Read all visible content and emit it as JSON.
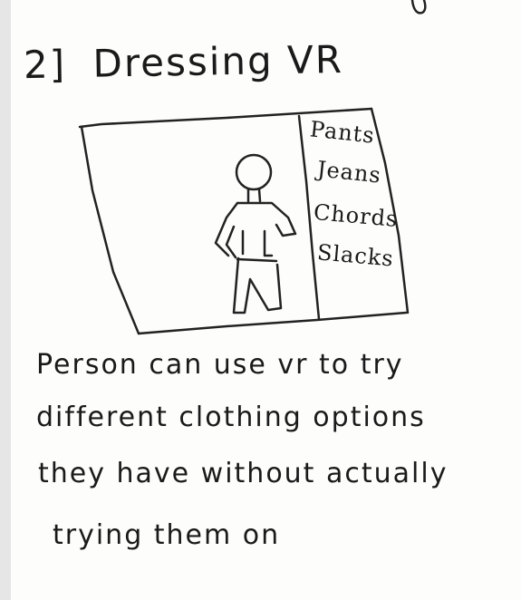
{
  "heading": {
    "number": "2]",
    "title": "Dressing VR"
  },
  "menu": {
    "items": [
      {
        "label": "Pants"
      },
      {
        "label": "Jeans"
      },
      {
        "label": "Chords"
      },
      {
        "label": "Slacks"
      }
    ]
  },
  "description": {
    "lines": [
      "Person can use vr to try",
      "different clothing options",
      "they have without actually",
      "trying them on"
    ]
  }
}
